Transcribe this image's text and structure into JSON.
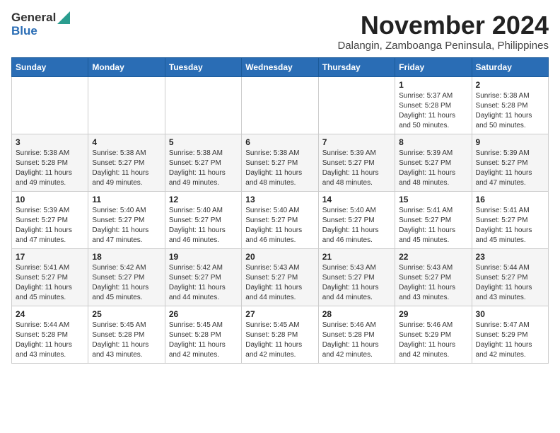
{
  "header": {
    "logo_general": "General",
    "logo_blue": "Blue",
    "title": "November 2024",
    "location": "Dalangin, Zamboanga Peninsula, Philippines"
  },
  "days_of_week": [
    "Sunday",
    "Monday",
    "Tuesday",
    "Wednesday",
    "Thursday",
    "Friday",
    "Saturday"
  ],
  "weeks": [
    [
      {
        "day": "",
        "info": ""
      },
      {
        "day": "",
        "info": ""
      },
      {
        "day": "",
        "info": ""
      },
      {
        "day": "",
        "info": ""
      },
      {
        "day": "",
        "info": ""
      },
      {
        "day": "1",
        "info": "Sunrise: 5:37 AM\nSunset: 5:28 PM\nDaylight: 11 hours and 50 minutes."
      },
      {
        "day": "2",
        "info": "Sunrise: 5:38 AM\nSunset: 5:28 PM\nDaylight: 11 hours and 50 minutes."
      }
    ],
    [
      {
        "day": "3",
        "info": "Sunrise: 5:38 AM\nSunset: 5:28 PM\nDaylight: 11 hours and 49 minutes."
      },
      {
        "day": "4",
        "info": "Sunrise: 5:38 AM\nSunset: 5:27 PM\nDaylight: 11 hours and 49 minutes."
      },
      {
        "day": "5",
        "info": "Sunrise: 5:38 AM\nSunset: 5:27 PM\nDaylight: 11 hours and 49 minutes."
      },
      {
        "day": "6",
        "info": "Sunrise: 5:38 AM\nSunset: 5:27 PM\nDaylight: 11 hours and 48 minutes."
      },
      {
        "day": "7",
        "info": "Sunrise: 5:39 AM\nSunset: 5:27 PM\nDaylight: 11 hours and 48 minutes."
      },
      {
        "day": "8",
        "info": "Sunrise: 5:39 AM\nSunset: 5:27 PM\nDaylight: 11 hours and 48 minutes."
      },
      {
        "day": "9",
        "info": "Sunrise: 5:39 AM\nSunset: 5:27 PM\nDaylight: 11 hours and 47 minutes."
      }
    ],
    [
      {
        "day": "10",
        "info": "Sunrise: 5:39 AM\nSunset: 5:27 PM\nDaylight: 11 hours and 47 minutes."
      },
      {
        "day": "11",
        "info": "Sunrise: 5:40 AM\nSunset: 5:27 PM\nDaylight: 11 hours and 47 minutes."
      },
      {
        "day": "12",
        "info": "Sunrise: 5:40 AM\nSunset: 5:27 PM\nDaylight: 11 hours and 46 minutes."
      },
      {
        "day": "13",
        "info": "Sunrise: 5:40 AM\nSunset: 5:27 PM\nDaylight: 11 hours and 46 minutes."
      },
      {
        "day": "14",
        "info": "Sunrise: 5:40 AM\nSunset: 5:27 PM\nDaylight: 11 hours and 46 minutes."
      },
      {
        "day": "15",
        "info": "Sunrise: 5:41 AM\nSunset: 5:27 PM\nDaylight: 11 hours and 45 minutes."
      },
      {
        "day": "16",
        "info": "Sunrise: 5:41 AM\nSunset: 5:27 PM\nDaylight: 11 hours and 45 minutes."
      }
    ],
    [
      {
        "day": "17",
        "info": "Sunrise: 5:41 AM\nSunset: 5:27 PM\nDaylight: 11 hours and 45 minutes."
      },
      {
        "day": "18",
        "info": "Sunrise: 5:42 AM\nSunset: 5:27 PM\nDaylight: 11 hours and 45 minutes."
      },
      {
        "day": "19",
        "info": "Sunrise: 5:42 AM\nSunset: 5:27 PM\nDaylight: 11 hours and 44 minutes."
      },
      {
        "day": "20",
        "info": "Sunrise: 5:43 AM\nSunset: 5:27 PM\nDaylight: 11 hours and 44 minutes."
      },
      {
        "day": "21",
        "info": "Sunrise: 5:43 AM\nSunset: 5:27 PM\nDaylight: 11 hours and 44 minutes."
      },
      {
        "day": "22",
        "info": "Sunrise: 5:43 AM\nSunset: 5:27 PM\nDaylight: 11 hours and 43 minutes."
      },
      {
        "day": "23",
        "info": "Sunrise: 5:44 AM\nSunset: 5:27 PM\nDaylight: 11 hours and 43 minutes."
      }
    ],
    [
      {
        "day": "24",
        "info": "Sunrise: 5:44 AM\nSunset: 5:28 PM\nDaylight: 11 hours and 43 minutes."
      },
      {
        "day": "25",
        "info": "Sunrise: 5:45 AM\nSunset: 5:28 PM\nDaylight: 11 hours and 43 minutes."
      },
      {
        "day": "26",
        "info": "Sunrise: 5:45 AM\nSunset: 5:28 PM\nDaylight: 11 hours and 42 minutes."
      },
      {
        "day": "27",
        "info": "Sunrise: 5:45 AM\nSunset: 5:28 PM\nDaylight: 11 hours and 42 minutes."
      },
      {
        "day": "28",
        "info": "Sunrise: 5:46 AM\nSunset: 5:28 PM\nDaylight: 11 hours and 42 minutes."
      },
      {
        "day": "29",
        "info": "Sunrise: 5:46 AM\nSunset: 5:29 PM\nDaylight: 11 hours and 42 minutes."
      },
      {
        "day": "30",
        "info": "Sunrise: 5:47 AM\nSunset: 5:29 PM\nDaylight: 11 hours and 42 minutes."
      }
    ]
  ]
}
